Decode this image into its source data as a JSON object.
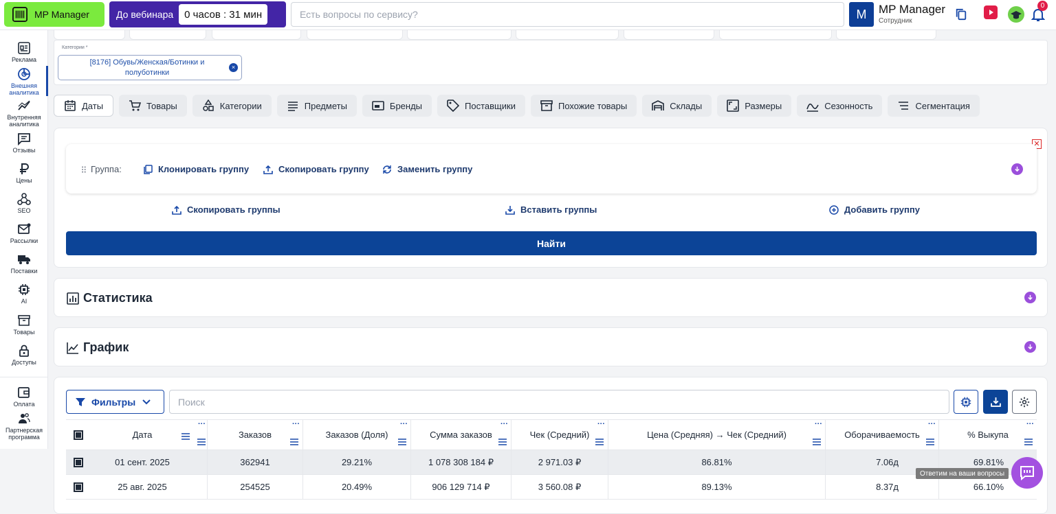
{
  "topbar": {
    "logo_text": "MP Manager",
    "webinar_label": "До вебинара",
    "timer": "0 часов : 31 мин",
    "search_placeholder": "Есть вопросы по сервису?",
    "account_initial": "M",
    "account_name": "MP Manager",
    "account_role": "Сотрудник",
    "notification_count": "0"
  },
  "sidebar": {
    "items": [
      {
        "label": "Реклама",
        "icon": "ads-icon"
      },
      {
        "label": "Внешняя аналитика",
        "icon": "external-analytics-icon",
        "active": true
      },
      {
        "label": "Внутренняя аналитика",
        "icon": "internal-analytics-icon"
      },
      {
        "label": "Отзывы",
        "icon": "reviews-icon"
      },
      {
        "label": "Цены",
        "icon": "ruble-icon"
      },
      {
        "label": "SEO",
        "icon": "seo-icon"
      },
      {
        "label": "Рассылки",
        "icon": "mail-icon"
      },
      {
        "label": "Поставки",
        "icon": "truck-icon"
      },
      {
        "label": "AI",
        "icon": "chip-icon"
      },
      {
        "label": "Товары",
        "icon": "box-icon"
      },
      {
        "label": "Доступы",
        "icon": "lock-icon"
      },
      {
        "label": "Оплата",
        "icon": "wallet-icon"
      },
      {
        "label": "Партнерская программа",
        "icon": "partners-icon"
      }
    ]
  },
  "category": {
    "label": "Категории *",
    "chip": "[8176] Обувь/Женская/Ботинки и полуботинки"
  },
  "tabs": [
    {
      "label": "Даты",
      "icon": "calendar-icon",
      "active": true
    },
    {
      "label": "Товары",
      "icon": "cart-icon"
    },
    {
      "label": "Категории",
      "icon": "categories-icon"
    },
    {
      "label": "Предметы",
      "icon": "list-icon"
    },
    {
      "label": "Бренды",
      "icon": "brand-icon"
    },
    {
      "label": "Поставщики",
      "icon": "tag-icon"
    },
    {
      "label": "Похожие товары",
      "icon": "archive-icon"
    },
    {
      "label": "Склады",
      "icon": "warehouse-icon"
    },
    {
      "label": "Размеры",
      "icon": "size-icon"
    },
    {
      "label": "Сезонность",
      "icon": "season-icon"
    },
    {
      "label": "Сегментация",
      "icon": "segment-icon"
    }
  ],
  "group": {
    "label": "Группа:",
    "clone": "Клонировать группу",
    "copy": "Скопировать группу",
    "replace": "Заменить группу"
  },
  "group_actions": {
    "copy_groups": "Скопировать группы",
    "paste_groups": "Вставить группы",
    "add_group": "Добавить группу"
  },
  "find_button": "Найти",
  "sections": {
    "stats": "Статистика",
    "chart": "График"
  },
  "table_controls": {
    "filters": "Фильтры",
    "search_placeholder": "Поиск"
  },
  "table": {
    "columns": [
      "Дата",
      "Заказов",
      "Заказов (Доля)",
      "Сумма заказов",
      "Чек (Средний)",
      "Цена (Средняя) → Чек (Средний)",
      "Оборачиваемость",
      "% Выкупа"
    ],
    "rows": [
      [
        "01 сент. 2025",
        "362941",
        "29.21%",
        "1 078 308 184 ₽",
        "2 971.03 ₽",
        "86.81%",
        "7.06д",
        "69.81%"
      ],
      [
        "25 авг. 2025",
        "254525",
        "20.49%",
        "906 129 714 ₽",
        "3 560.08 ₽",
        "89.13%",
        "8.37д",
        "66.10%"
      ]
    ]
  },
  "help": {
    "tooltip": "Ответим на ваши вопросы"
  }
}
